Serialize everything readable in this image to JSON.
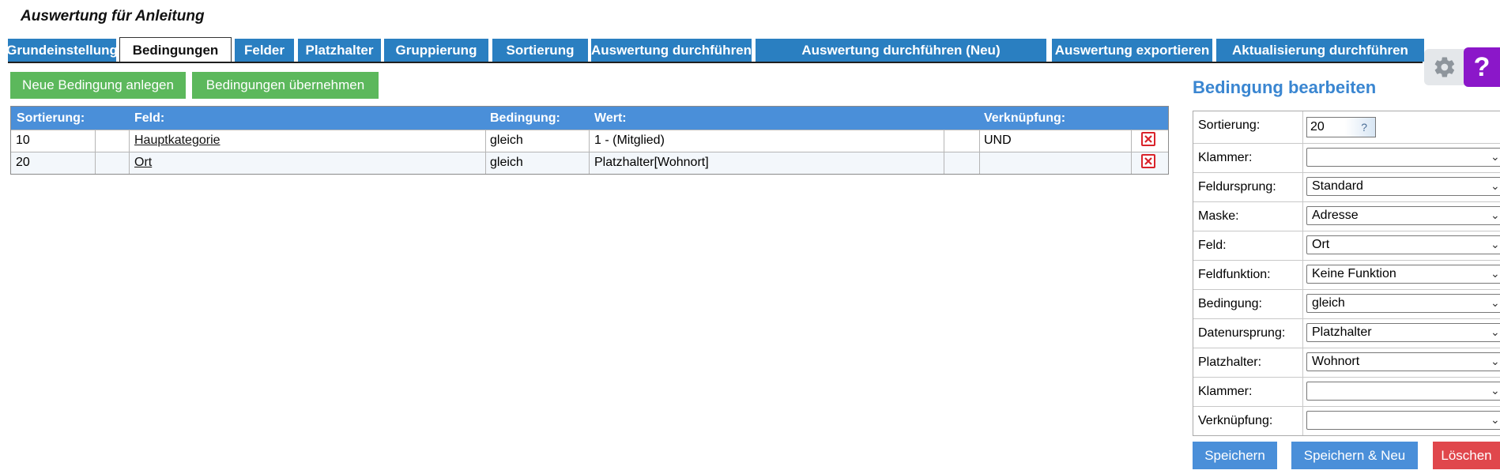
{
  "page": {
    "title": "Auswertung für Anleitung"
  },
  "tabs": [
    {
      "label": "Grundeinstellung"
    },
    {
      "label": "Bedingungen",
      "active": true
    },
    {
      "label": "Felder"
    },
    {
      "label": "Platzhalter"
    },
    {
      "label": "Gruppierung"
    },
    {
      "label": "Sortierung"
    },
    {
      "label": "Auswertung durchführen"
    },
    {
      "label": "Auswertung durchführen (Neu)"
    },
    {
      "label": "Auswertung exportieren"
    },
    {
      "label": "Aktualisierung durchführen"
    }
  ],
  "actions": {
    "new_condition": "Neue Bedingung anlegen",
    "apply_conditions": "Bedingungen übernehmen"
  },
  "table": {
    "headers": {
      "sortierung": "Sortierung:",
      "feld": "Feld:",
      "bedingung": "Bedingung:",
      "wert": "Wert:",
      "verknuepfung": "Verknüpfung:"
    },
    "rows": [
      {
        "sortierung": "10",
        "feld": "Hauptkategorie",
        "bedingung": "gleich",
        "wert": "1 - (Mitglied)",
        "verknuepfung": "UND"
      },
      {
        "sortierung": "20",
        "feld": "Ort",
        "bedingung": "gleich",
        "wert": "Platzhalter[Wohnort]",
        "verknuepfung": ""
      }
    ]
  },
  "panel": {
    "title": "Bedingung bearbeiten",
    "fields": {
      "sortierung": {
        "label": "Sortierung:",
        "value": "20",
        "help": "?"
      },
      "klammer_open": {
        "label": "Klammer:",
        "value": ""
      },
      "feldursprung": {
        "label": "Feldursprung:",
        "value": "Standard"
      },
      "maske": {
        "label": "Maske:",
        "value": "Adresse"
      },
      "feld": {
        "label": "Feld:",
        "value": "Ort"
      },
      "feldfunktion": {
        "label": "Feldfunktion:",
        "value": "Keine Funktion"
      },
      "bedingung": {
        "label": "Bedingung:",
        "value": "gleich"
      },
      "datenursprung": {
        "label": "Datenursprung:",
        "value": "Platzhalter"
      },
      "platzhalter": {
        "label": "Platzhalter:",
        "value": "Wohnort"
      },
      "klammer_close": {
        "label": "Klammer:",
        "value": ""
      },
      "verknuepfung": {
        "label": "Verknüpfung:",
        "value": ""
      }
    },
    "buttons": {
      "save": "Speichern",
      "save_new": "Speichern & Neu",
      "delete": "Löschen"
    }
  },
  "tools": {
    "help_label": "?"
  },
  "colors": {
    "tab_blue": "#2a7fc1",
    "header_blue": "#4a8fd9",
    "green": "#5cb85c",
    "red": "#e0474c",
    "purple": "#8b17c9"
  }
}
